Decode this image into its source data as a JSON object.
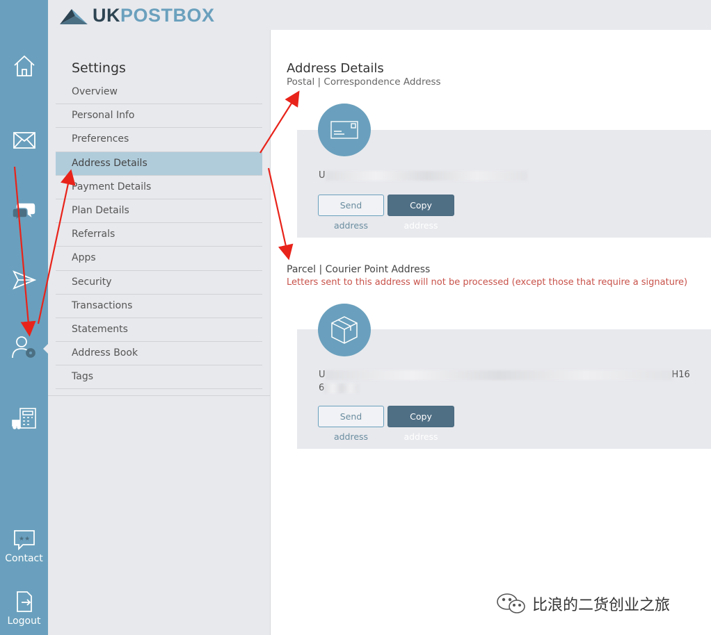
{
  "brand": {
    "uk": "UK",
    "post": "POSTBOX"
  },
  "rail": {
    "contact_label": "Contact",
    "logout_label": "Logout"
  },
  "settings": {
    "title": "Settings",
    "items": [
      {
        "label": "Overview"
      },
      {
        "label": "Personal Info"
      },
      {
        "label": "Preferences"
      },
      {
        "label": "Address Details"
      },
      {
        "label": "Payment Details"
      },
      {
        "label": "Plan Details"
      },
      {
        "label": "Referrals"
      },
      {
        "label": "Apps"
      },
      {
        "label": "Security"
      },
      {
        "label": "Transactions"
      },
      {
        "label": "Statements"
      },
      {
        "label": "Address Book"
      },
      {
        "label": "Tags"
      }
    ],
    "active_index": 3
  },
  "main": {
    "title": "Address Details",
    "postal": {
      "subtitle": "Postal | Correspondence Address",
      "address_visible_start": "U",
      "send_label": "Send address",
      "copy_label": "Copy address"
    },
    "parcel": {
      "title": "Parcel | Courier Point Address",
      "warning": "Letters sent to this address will not be processed (except those that require a signature)",
      "address_visible_start": "U",
      "address_visible_end": "H16",
      "address_line2_start": "6",
      "send_label": "Send address",
      "copy_label": "Copy address"
    }
  },
  "watermark": {
    "text": "比浪的二货创业之旅"
  },
  "colors": {
    "rail": "#6aa0bd",
    "panel": "#e8e9ed",
    "active_item": "#b0ccdb",
    "copy_button": "#4f6f85",
    "warning_text": "#c8524a",
    "annotation_arrow": "#e8231a"
  }
}
